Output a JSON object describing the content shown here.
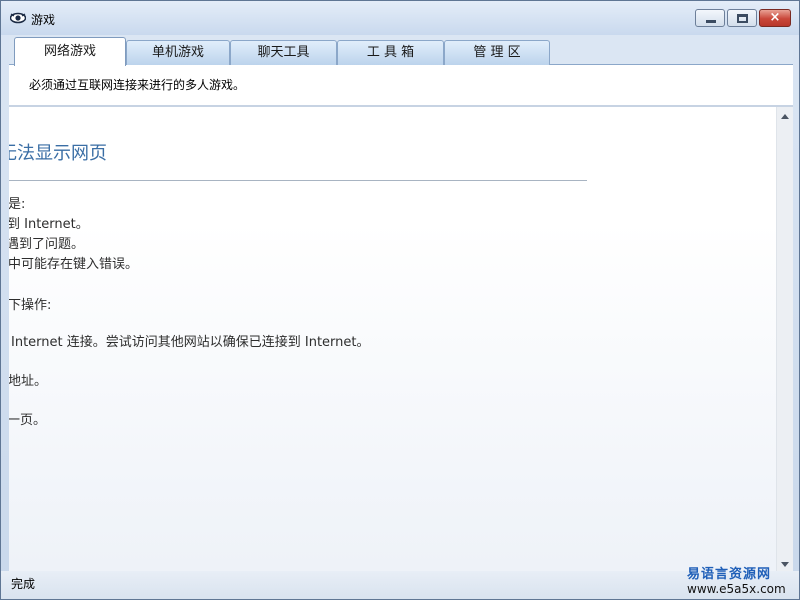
{
  "window": {
    "title": "游戏",
    "buttons": {
      "minimize": "minimize",
      "maximize": "maximize",
      "close": "×"
    }
  },
  "tabs": [
    {
      "label": "网络游戏",
      "active": true
    },
    {
      "label": "单机游戏",
      "active": false
    },
    {
      "label": "聊天工具",
      "active": false
    },
    {
      "label": "工 具 箱",
      "active": false
    },
    {
      "label": "管 理 区",
      "active": false
    }
  ],
  "tab_description": "必须通过互联网连接来进行的多人游戏。",
  "browser": {
    "error_title": "无法显示网页",
    "lines": [
      "是:",
      "到 Internet。",
      "遇到了问题。",
      "中可能存在键入错误。",
      "下操作:",
      "Internet 连接。尝试访问其他网站以确保已连接到 Internet。",
      "地址。",
      "一页。"
    ]
  },
  "status": {
    "text": "完成"
  },
  "watermark": {
    "line1": "易语言资源网",
    "line2": "www.e5a5x.com"
  },
  "colors": {
    "accent": "#3a6ea5",
    "close": "#c9473a"
  }
}
